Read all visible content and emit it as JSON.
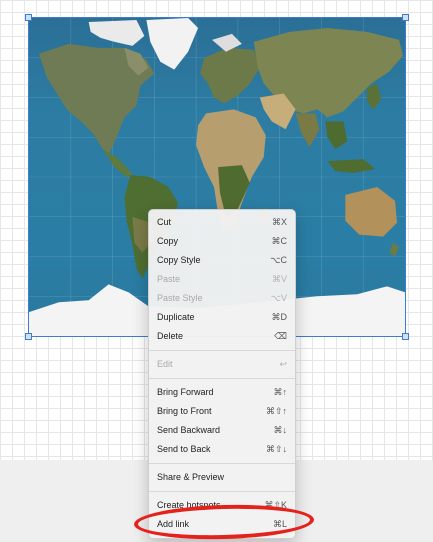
{
  "menu": {
    "cut": {
      "label": "Cut",
      "shortcut": "⌘X"
    },
    "copy": {
      "label": "Copy",
      "shortcut": "⌘C"
    },
    "copy_style": {
      "label": "Copy Style",
      "shortcut": "⌥C"
    },
    "paste": {
      "label": "Paste",
      "shortcut": "⌘V"
    },
    "paste_style": {
      "label": "Paste Style",
      "shortcut": "⌥V"
    },
    "duplicate": {
      "label": "Duplicate",
      "shortcut": "⌘D"
    },
    "delete": {
      "label": "Delete",
      "shortcut": "⌫"
    },
    "edit": {
      "label": "Edit",
      "shortcut": "↩"
    },
    "bring_forward": {
      "label": "Bring Forward",
      "shortcut": "⌘↑"
    },
    "bring_to_front": {
      "label": "Bring to Front",
      "shortcut": "⌘⇧↑"
    },
    "send_backward": {
      "label": "Send Backward",
      "shortcut": "⌘↓"
    },
    "send_to_back": {
      "label": "Send to Back",
      "shortcut": "⌘⇧↓"
    },
    "share_preview": {
      "label": "Share & Preview"
    },
    "create_hotspots": {
      "label": "Create hotspots",
      "shortcut": "⌘⇧K"
    },
    "add_link": {
      "label": "Add link",
      "shortcut": "⌘L"
    }
  },
  "colors": {
    "selection": "#3f7bd1",
    "annotation": "#e4221b",
    "ocean": "#2a7ea5"
  },
  "icons": {
    "delete_key": "backspace-icon",
    "return_key": "return-icon"
  }
}
